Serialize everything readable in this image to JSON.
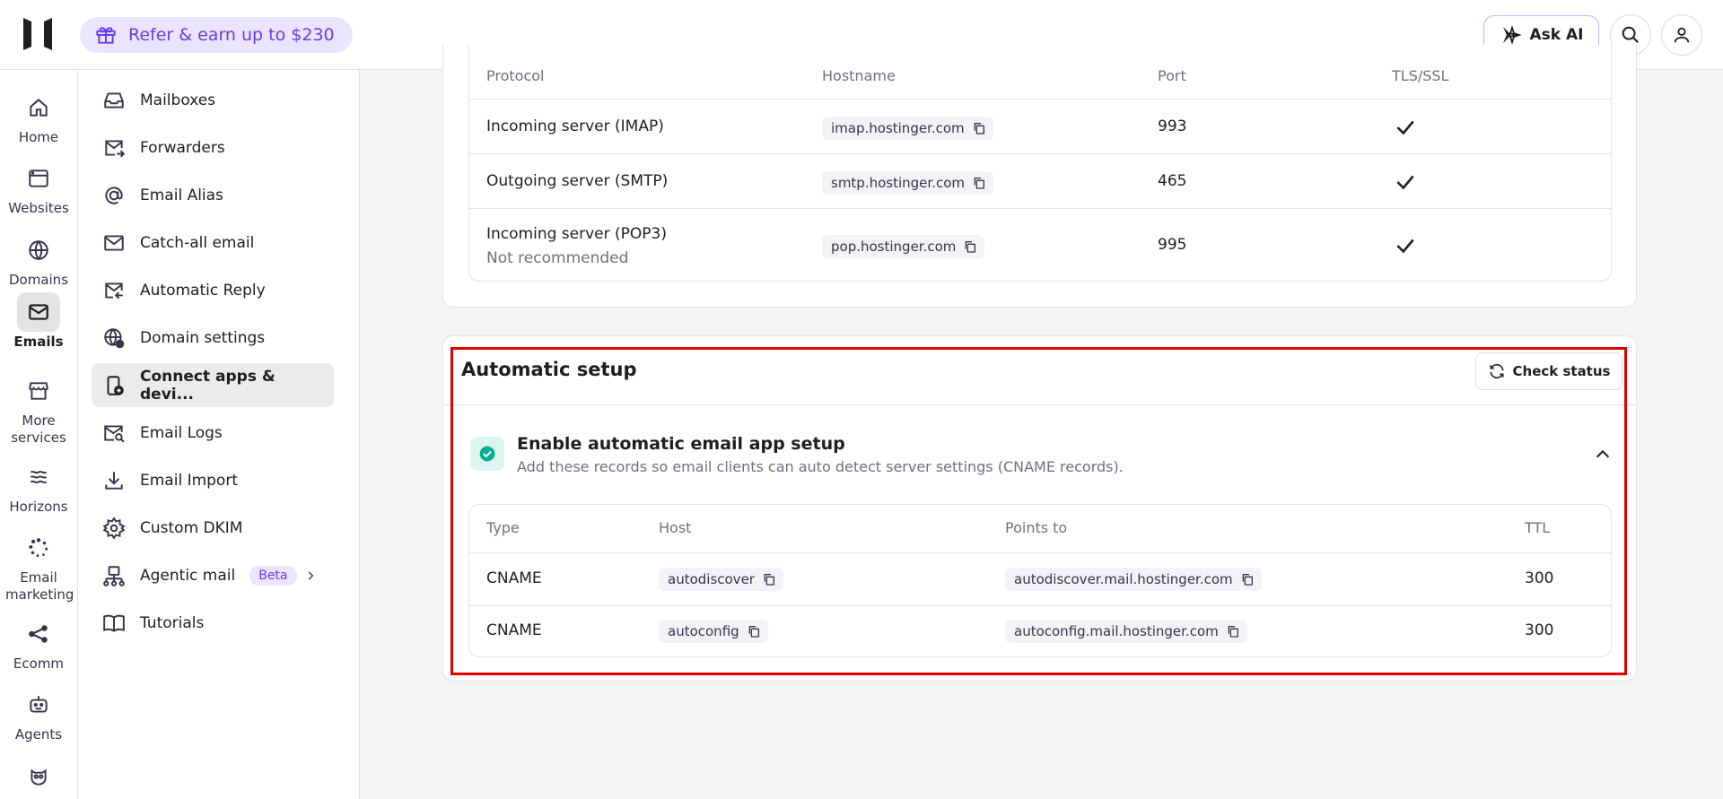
{
  "topbar": {
    "refer_label": "Refer & earn up to $230",
    "ask_ai_label": "Ask AI"
  },
  "rail": [
    {
      "label": "Home",
      "icon": "home-icon"
    },
    {
      "label": "Websites",
      "icon": "browser-icon"
    },
    {
      "label": "Domains",
      "icon": "globe-icon"
    },
    {
      "label": "Emails",
      "icon": "mail-icon",
      "active": true
    },
    {
      "label": "More services",
      "icon": "store-icon"
    },
    {
      "label": "Horizons",
      "icon": "waves-icon"
    },
    {
      "label": "Email marketing",
      "icon": "dots-spinner-icon"
    },
    {
      "label": "Ecomm",
      "icon": "share-nodes-icon"
    },
    {
      "label": "Agents",
      "icon": "robot-icon"
    }
  ],
  "subnav": [
    {
      "label": "Mailboxes",
      "icon": "inbox-icon"
    },
    {
      "label": "Forwarders",
      "icon": "mail-forward-icon"
    },
    {
      "label": "Email Alias",
      "icon": "at-icon"
    },
    {
      "label": "Catch-all email",
      "icon": "envelope-icon"
    },
    {
      "label": "Automatic Reply",
      "icon": "mail-reply-icon"
    },
    {
      "label": "Domain settings",
      "icon": "globe-settings-icon"
    },
    {
      "label": "Connect apps & devi...",
      "icon": "device-add-icon",
      "active": true
    },
    {
      "label": "Email Logs",
      "icon": "mail-search-icon"
    },
    {
      "label": "Email Import",
      "icon": "download-icon"
    },
    {
      "label": "Custom DKIM",
      "icon": "gear-icon"
    },
    {
      "label": "Agentic mail",
      "icon": "agent-network-icon",
      "badge": "Beta"
    },
    {
      "label": "Tutorials",
      "icon": "book-icon"
    }
  ],
  "servers": {
    "headers": {
      "protocol": "Protocol",
      "hostname": "Hostname",
      "port": "Port",
      "tls": "TLS/SSL"
    },
    "rows": [
      {
        "protocol": "Incoming server (IMAP)",
        "note": "",
        "hostname": "imap.hostinger.com",
        "port": "993",
        "tls": true
      },
      {
        "protocol": "Outgoing server (SMTP)",
        "note": "",
        "hostname": "smtp.hostinger.com",
        "port": "465",
        "tls": true
      },
      {
        "protocol": "Incoming server (POP3)",
        "note": "Not recommended",
        "hostname": "pop.hostinger.com",
        "port": "995",
        "tls": true
      }
    ]
  },
  "auto_setup": {
    "title": "Automatic setup",
    "check_status_label": "Check status",
    "enable_title": "Enable automatic email app setup",
    "enable_desc": "Add these records so email clients can auto detect server settings (CNAME records).",
    "headers": {
      "type": "Type",
      "host": "Host",
      "points_to": "Points to",
      "ttl": "TTL"
    },
    "records": [
      {
        "type": "CNAME",
        "host": "autodiscover",
        "points_to": "autodiscover.mail.hostinger.com",
        "ttl": "300"
      },
      {
        "type": "CNAME",
        "host": "autoconfig",
        "points_to": "autoconfig.mail.hostinger.com",
        "ttl": "300"
      }
    ]
  },
  "colors": {
    "accent": "#673de6",
    "success": "#00b090",
    "highlight": "#e00000"
  }
}
